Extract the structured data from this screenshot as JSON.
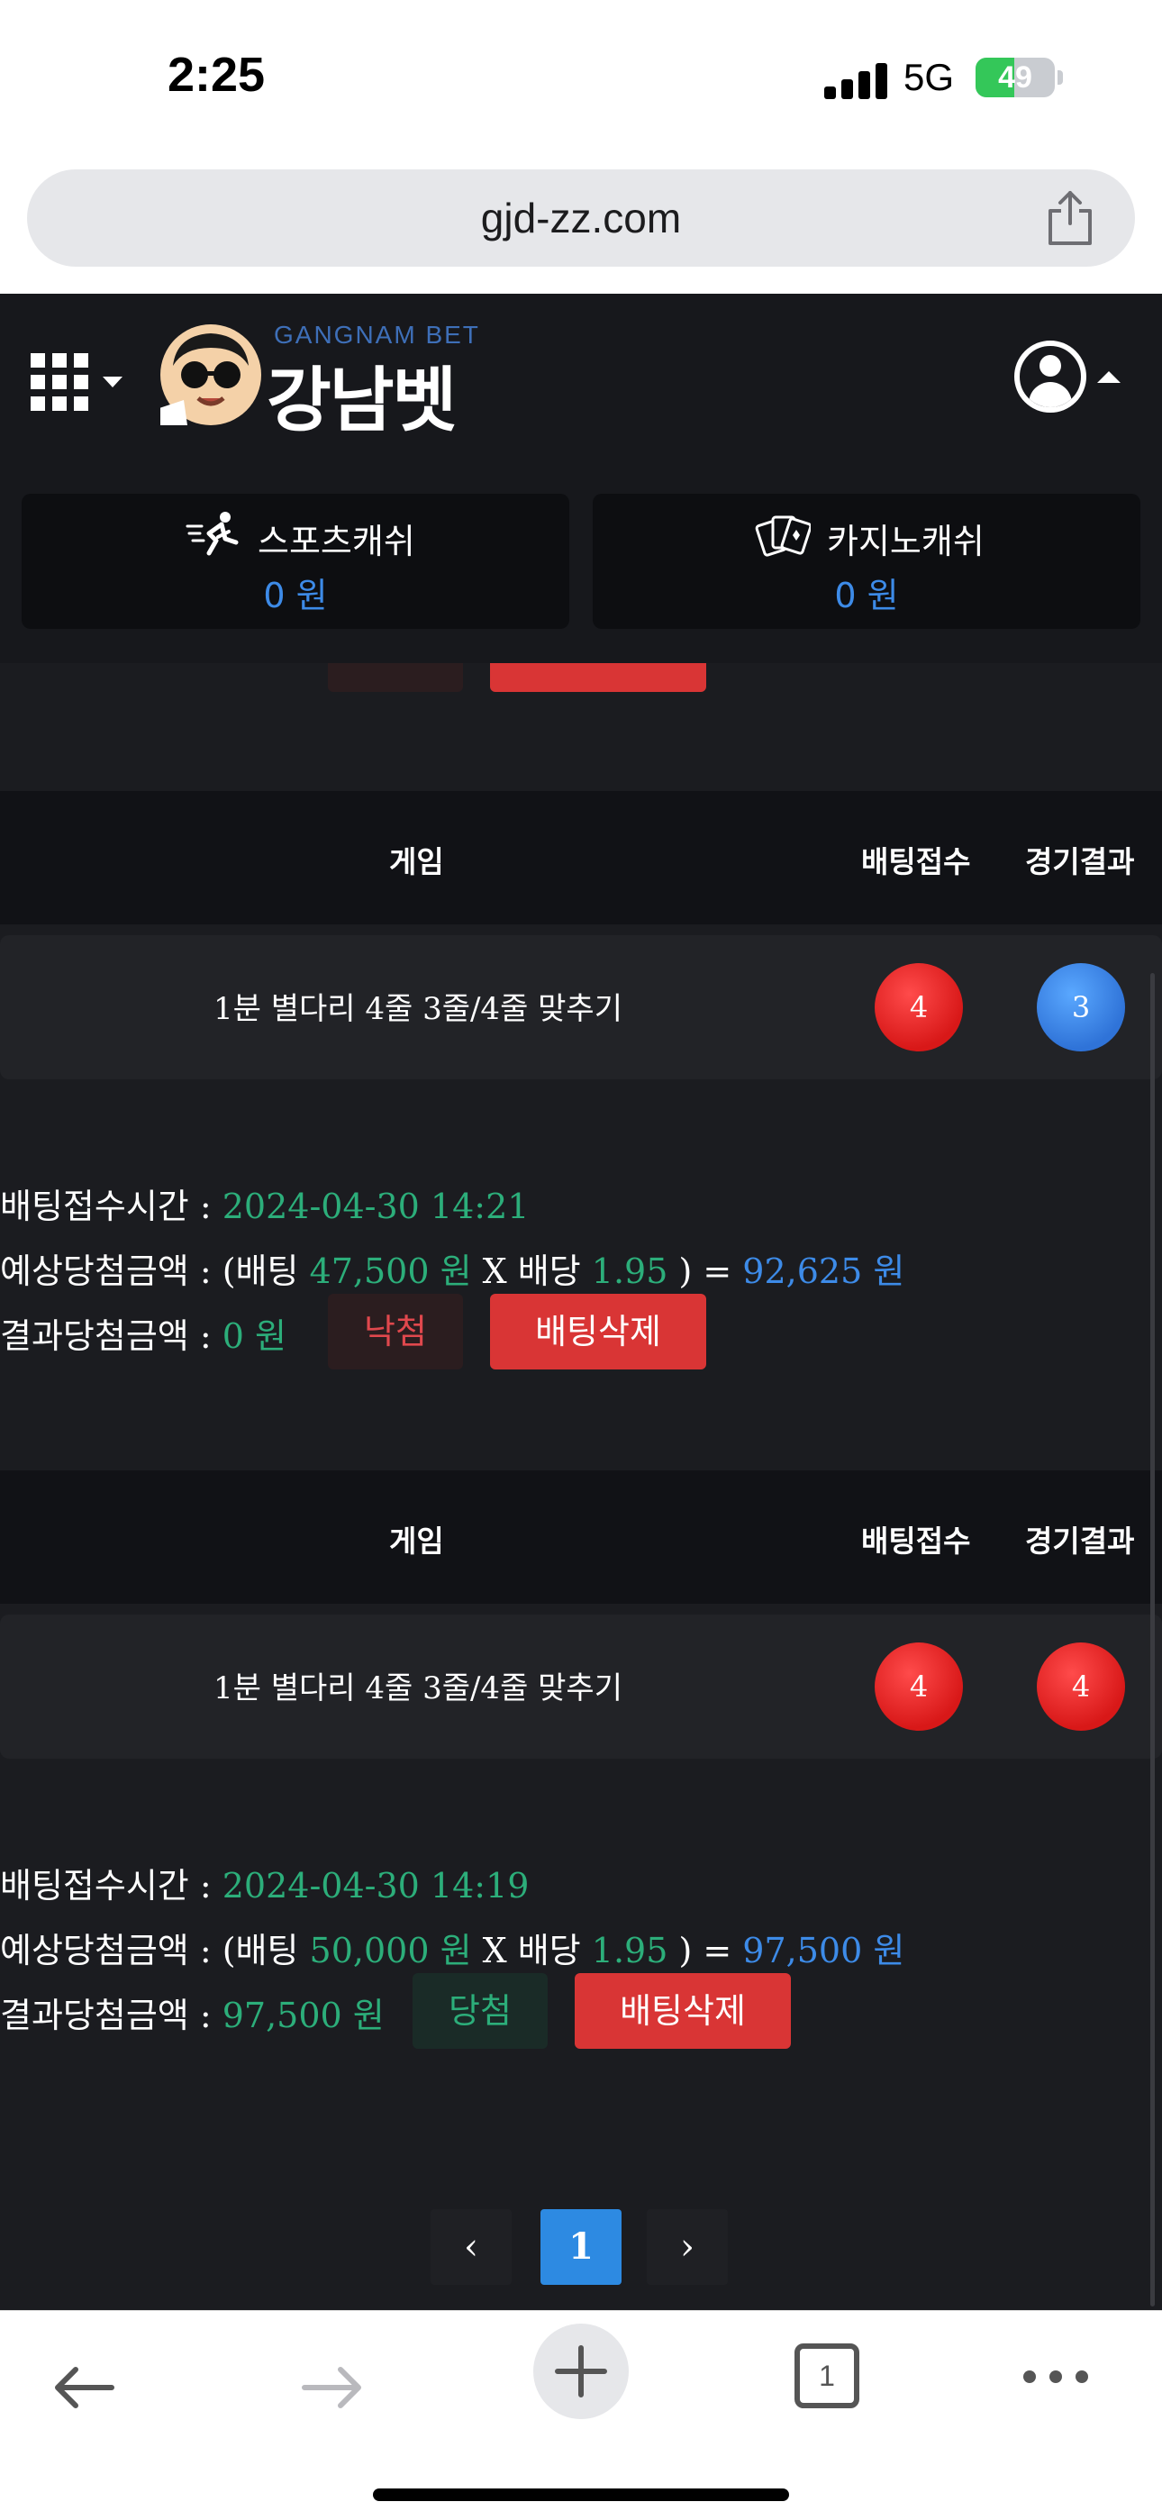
{
  "status_bar": {
    "time": "2:25",
    "network": "5G",
    "battery": "49",
    "battery_level": 0.49
  },
  "browser": {
    "url": "gjd-zz.com",
    "tab_count": "1"
  },
  "site": {
    "logo_sub": "GANGNAM BET",
    "logo_main": "강남벳"
  },
  "wallets": [
    {
      "label": "스포츠캐쉬",
      "value": "0 원",
      "icon": "running-person-icon"
    },
    {
      "label": "카지노캐쉬",
      "value": "0 원",
      "icon": "playing-cards-icon"
    }
  ],
  "table_headers": {
    "game": "게임",
    "bet_received": "배팅접수",
    "result": "경기결과"
  },
  "labels": {
    "bet_time": "배팅접수시간 : ",
    "expected_prefix": "예상당첨금액 : (배팅 ",
    "won": " 원",
    "x_odds": " X 배당 ",
    "close_eq": " ) = ",
    "result_amount": "결과당첨금액 : ",
    "delete": "배팅삭제"
  },
  "bets": [
    {
      "game": "1분 별다리 4줄 3줄/4줄 맞추기",
      "bet_pick": "4",
      "result": "3",
      "bet_time": "2024-04-30 14:21",
      "bet_amount": "47,500",
      "odds": "1.95",
      "expected": "92,625 원",
      "result_value": "0 원",
      "status": "낙첨"
    },
    {
      "game": "1분 별다리 4줄 3줄/4줄 맞추기",
      "bet_pick": "4",
      "result": "4",
      "bet_time": "2024-04-30 14:19",
      "bet_amount": "50,000",
      "odds": "1.95",
      "expected": "97,500 원",
      "result_value": "97,500 원",
      "status": "당첨"
    }
  ],
  "pagination": {
    "prev": "‹",
    "current": "1",
    "next": "›"
  },
  "colors": {
    "accent_blue": "#2d8ae2",
    "win_green": "#2cae7a",
    "lose_red": "#e0484d",
    "delete_red": "#d93535"
  }
}
